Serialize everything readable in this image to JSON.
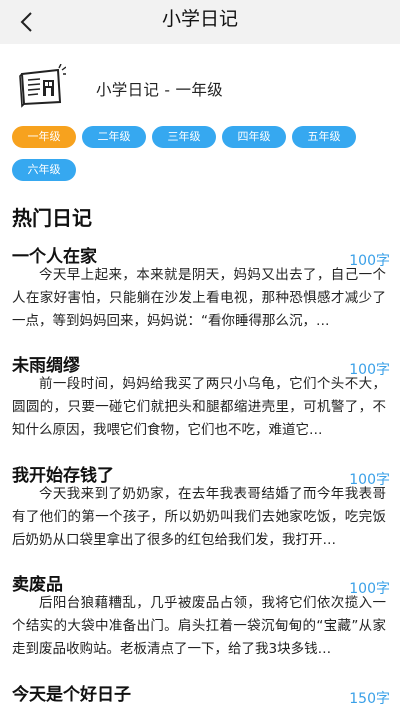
{
  "header": {
    "title": "小学日记"
  },
  "book": {
    "title": "小学日记 - 一年级",
    "icon": "book-cover-icon"
  },
  "grades": [
    {
      "label": "一年级",
      "active": true
    },
    {
      "label": "二年级",
      "active": false
    },
    {
      "label": "三年级",
      "active": false
    },
    {
      "label": "四年级",
      "active": false
    },
    {
      "label": "五年级",
      "active": false
    },
    {
      "label": "六年级",
      "active": false
    }
  ],
  "colors": {
    "active_grade": "#f7a21e",
    "grade": "#36a8f0",
    "word_count": "#3aa0e8"
  },
  "section_title": "热门日记",
  "articles": [
    {
      "title": "一个人在家",
      "count": "100字",
      "excerpt": "今天早上起来，本来就是阴天，妈妈又出去了，自己一个人在家好害怕，只能躺在沙发上看电视，那种恐惧感才减少了一点，等到妈妈回来，妈妈说：“看你睡得那么沉，…"
    },
    {
      "title": "未雨绸缪",
      "count": "100字",
      "excerpt": "前一段时间，妈妈给我买了两只小乌龟，它们个头不大，圆圆的，只要一碰它们就把头和腿都缩进壳里，可机警了，不知什么原因，我喂它们食物，它们也不吃，难道它…"
    },
    {
      "title": "我开始存钱了",
      "count": "100字",
      "excerpt": "今天我来到了奶奶家，在去年我表哥结婚了而今年我表哥有了他们的第一个孩子，所以奶奶叫我们去她家吃饭，吃完饭后奶奶从口袋里拿出了很多的红包给我们发，我打开…"
    },
    {
      "title": "卖废品",
      "count": "100字",
      "excerpt": "后阳台狼藉糟乱，几乎被废品占领，我将它们依次揽入一个结实的大袋中准备出门。肩头扛着一袋沉甸甸的“宝藏”从家走到废品收购站。老板清点了一下，给了我3块多钱…"
    },
    {
      "title": "今天是个好日子",
      "count": "150字",
      "excerpt": ""
    }
  ]
}
